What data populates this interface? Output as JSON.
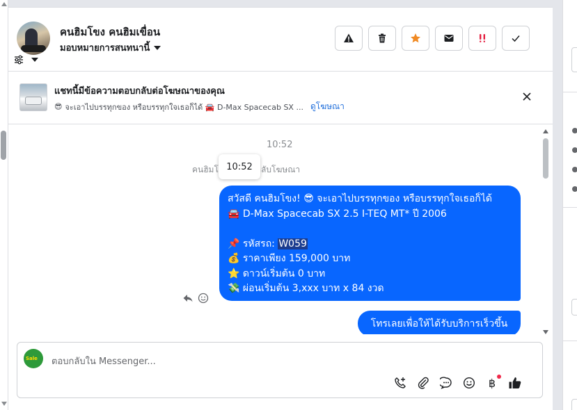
{
  "header": {
    "contact_name": "คนฮิมโขง คนฮิมเขื่อน",
    "assign_label": "มอบหมายการสนทนานี้",
    "actions": [
      {
        "name": "report-spam-button",
        "icon": "warning-icon"
      },
      {
        "name": "delete-button",
        "icon": "trash-icon"
      },
      {
        "name": "star-button",
        "icon": "star-icon"
      },
      {
        "name": "mark-unread-button",
        "icon": "envelope-icon"
      },
      {
        "name": "follow-up-button",
        "icon": "double-exclamation-icon"
      },
      {
        "name": "mark-done-button",
        "icon": "check-icon"
      }
    ]
  },
  "ad_banner": {
    "title": "แชทนี้มีข้อความตอบกลับต่อโฆษณาของคุณ",
    "subtitle_prefix": "😎",
    "subtitle_text": "จะเอาไปบรรทุกของ หรือบรรทุกใจเธอก็ได้ 🚘 D-Max Spacecab SX ...",
    "link": "ดูโฆษณา"
  },
  "chat": {
    "timestamp": "10:52",
    "tooltip_time": "10:52",
    "sender_note": "คนฮิมโ          ขื่อน ตอบกลับโฆษณา",
    "message_lines": [
      "สวัสดี คนฮิมโขง! 😎 จะเอาไปบรรทุกของ หรือบรรทุกใจเธอก็ได้",
      "🚘 D-Max Spacecab SX 2.5 I-TEQ MT* ปี 2006",
      "",
      "📌 รหัสรถ: ",
      "💰 ราคาเพียง 159,000 บาท",
      "⭐ ดาวน์เริ่มต้น 0 บาท",
      "💸 ผ่อนเริ่มต้น 3,xxx บาท x 84 งวด"
    ],
    "highlight_code": "W059",
    "cta_text": "โทรเลยเพื่อให้ได้รับบริการเร็วขึ้น"
  },
  "composer": {
    "placeholder": "ตอบกลับใน Messenger...",
    "avatar_text": "Sale",
    "tools": [
      "call-request-icon",
      "attachment-icon",
      "saved-reply-icon",
      "emoji-icon",
      "payment-baht-icon",
      "thumbs-up-icon"
    ]
  },
  "colors": {
    "bubble": "#0866ff",
    "link": "#216fdb",
    "star": "#f08a24",
    "follow_up": "#e41e3f"
  }
}
